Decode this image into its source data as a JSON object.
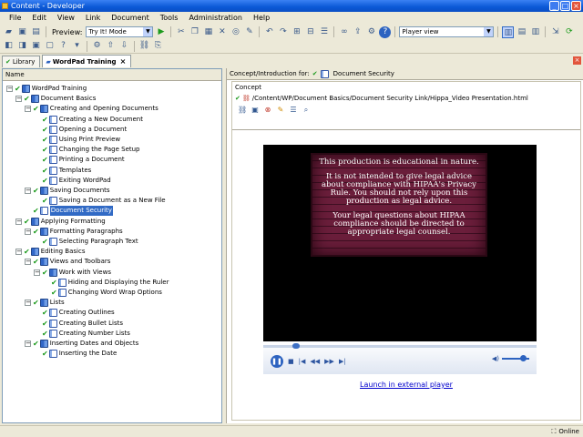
{
  "window": {
    "title": "Content - Developer"
  },
  "menu": [
    "File",
    "Edit",
    "View",
    "Link",
    "Document",
    "Tools",
    "Administration",
    "Help"
  ],
  "toolbar": {
    "preview_label": "Preview:",
    "mode_value": "Try It! Mode",
    "player_view_value": "Player view"
  },
  "tabs": [
    {
      "label": "Library",
      "active": false
    },
    {
      "label": "WordPad Training",
      "active": true
    }
  ],
  "tree": {
    "column_header": "Name",
    "items": [
      {
        "label": "WordPad Training",
        "level": 0,
        "icon": "book-icon",
        "expanded": true,
        "checked": true
      },
      {
        "label": "Document Basics",
        "level": 1,
        "icon": "book-icon",
        "expanded": true,
        "checked": true
      },
      {
        "label": "Creating and Opening Documents",
        "level": 2,
        "icon": "book-icon",
        "expanded": true,
        "checked": true
      },
      {
        "label": "Creating a New Document",
        "level": 3,
        "icon": "page-icon",
        "checked": true
      },
      {
        "label": "Opening a Document",
        "level": 3,
        "icon": "page-icon",
        "checked": true
      },
      {
        "label": "Using Print Preview",
        "level": 3,
        "icon": "page-icon",
        "checked": true
      },
      {
        "label": "Changing the Page Setup",
        "level": 3,
        "icon": "page-icon",
        "checked": true
      },
      {
        "label": "Printing a Document",
        "level": 3,
        "icon": "page-icon",
        "checked": true
      },
      {
        "label": "Templates",
        "level": 3,
        "icon": "page-icon",
        "checked": true
      },
      {
        "label": "Exiting WordPad",
        "level": 3,
        "icon": "page-icon",
        "checked": true
      },
      {
        "label": "Saving Documents",
        "level": 2,
        "icon": "book-icon",
        "expanded": true,
        "checked": true
      },
      {
        "label": "Saving a Document as a New File",
        "level": 3,
        "icon": "page-icon",
        "checked": true
      },
      {
        "label": "Document Security",
        "level": 2,
        "icon": "page-icon",
        "checked": true,
        "selected": true
      },
      {
        "label": "Applying Formatting",
        "level": 1,
        "icon": "book-icon",
        "expanded": true,
        "checked": true
      },
      {
        "label": "Formatting Paragraphs",
        "level": 2,
        "icon": "book-icon",
        "expanded": true,
        "checked": true
      },
      {
        "label": "Selecting Paragraph Text",
        "level": 3,
        "icon": "page-icon",
        "checked": true
      },
      {
        "label": "Editing Basics",
        "level": 1,
        "icon": "book-icon",
        "expanded": true,
        "checked": true
      },
      {
        "label": "Views and Toolbars",
        "level": 2,
        "icon": "book-icon",
        "expanded": true,
        "checked": true
      },
      {
        "label": "Work with Views",
        "level": 3,
        "icon": "book-icon",
        "expanded": true,
        "checked": true
      },
      {
        "label": "Hiding and Displaying the Ruler",
        "level": 4,
        "icon": "page-icon",
        "checked": true
      },
      {
        "label": "Changing Word Wrap Options",
        "level": 4,
        "icon": "page-icon",
        "checked": true
      },
      {
        "label": "Lists",
        "level": 2,
        "icon": "book-icon",
        "expanded": true,
        "checked": true
      },
      {
        "label": "Creating Outlines",
        "level": 3,
        "icon": "page-icon",
        "checked": true
      },
      {
        "label": "Creating Bullet Lists",
        "level": 3,
        "icon": "page-icon",
        "checked": true
      },
      {
        "label": "Creating Number Lists",
        "level": 3,
        "icon": "page-icon",
        "checked": true
      },
      {
        "label": "Inserting Dates and Objects",
        "level": 2,
        "icon": "book-icon",
        "expanded": true,
        "checked": true
      },
      {
        "label": "Inserting the Date",
        "level": 3,
        "icon": "page-icon",
        "checked": true
      }
    ]
  },
  "concept": {
    "header_label": "Concept/Introduction for:",
    "header_value": "Document Security",
    "box_title": "Concept",
    "path": "/Content/WP/Document Basics/Document Security Link/Hippa_Video Presentation.html",
    "video_text": [
      "This production is educational in nature.",
      "It is not intended to give legal advice about compliance with HIPAA's Privacy Rule. You should not rely upon this production as legal advice.",
      "Your legal questions about HIPAA compliance should be directed to appropriate legal counsel."
    ],
    "launch_link": "Launch in external player"
  },
  "status": {
    "text": "Online"
  },
  "colors": {
    "title_bar": "#0a58d6",
    "selection": "#316ac5",
    "brick": "#6b1e3b",
    "link": "#0000cc"
  }
}
